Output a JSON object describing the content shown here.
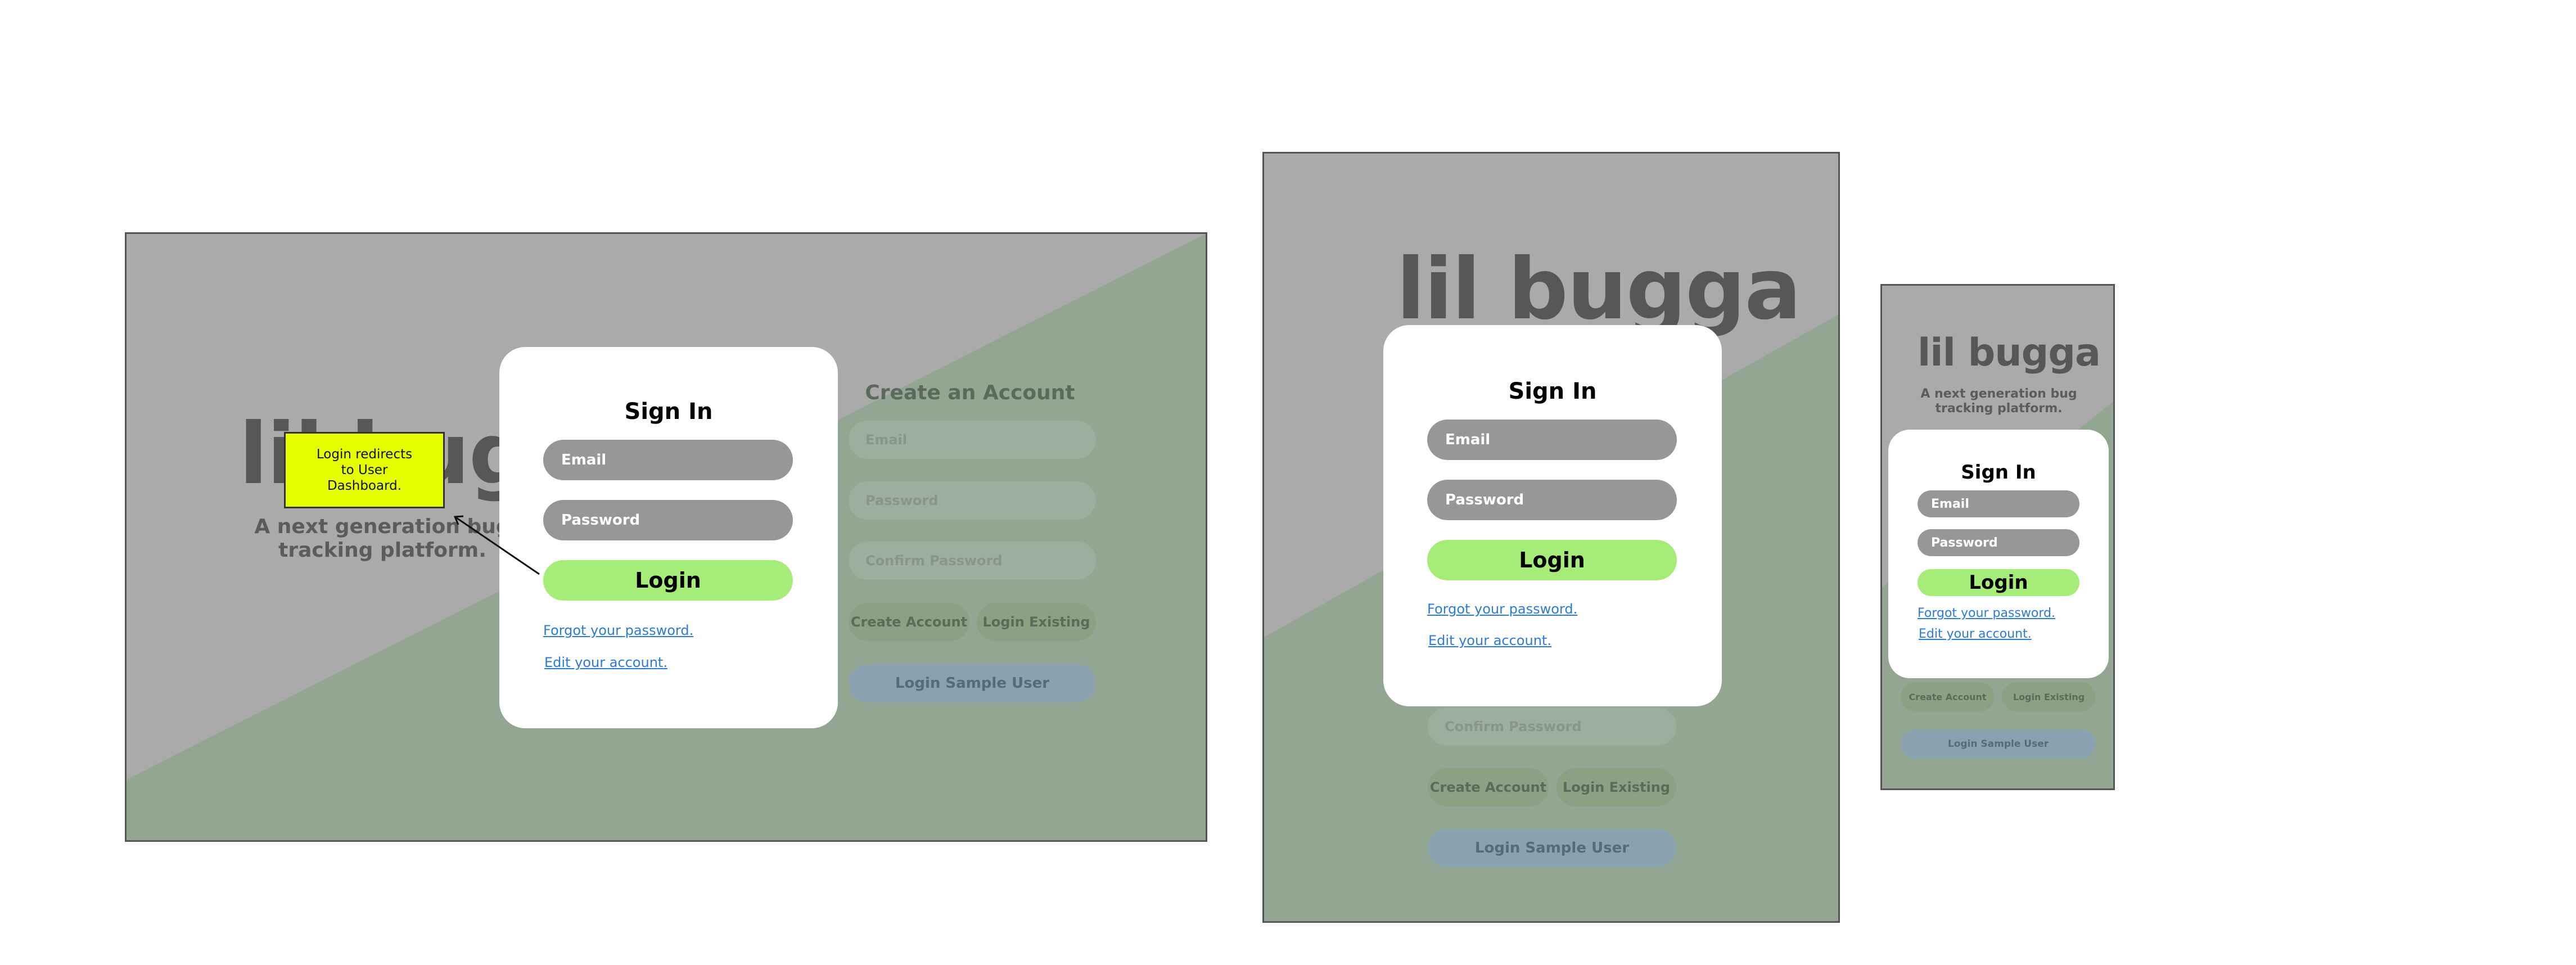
{
  "app": {
    "logo": "lil bugga",
    "tagline": "A next generation bug tracking platform."
  },
  "signin": {
    "title": "Sign In",
    "email_placeholder": "Email",
    "password_placeholder": "Password",
    "login_label": "Login",
    "forgot_link": "Forgot your password.",
    "edit_link": "Edit your account."
  },
  "create_account": {
    "title": "Create an Account",
    "email_placeholder": "Email",
    "password_placeholder": "Password",
    "confirm_placeholder": "Confirm Password",
    "create_label": "Create Account",
    "existing_label": "Login Existing",
    "sample_label": "Login Sample User"
  },
  "annotation": {
    "text": "Login redirects to User Dashboard."
  },
  "colors": {
    "green_bg": "#92a692",
    "gray_bg": "#aaaaaa",
    "login_button": "#a6ec78",
    "field": "#979797",
    "link": "#2b7bd8",
    "note": "#e6ff00"
  }
}
